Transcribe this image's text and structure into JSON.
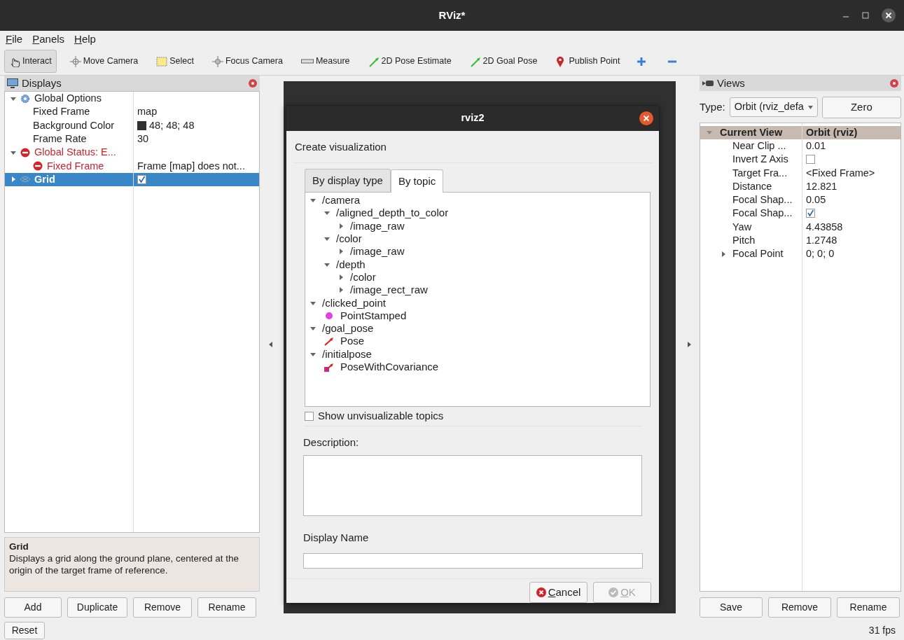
{
  "window": {
    "title": "RViz*"
  },
  "menu": [
    {
      "label": "File"
    },
    {
      "label": "Panels"
    },
    {
      "label": "Help"
    }
  ],
  "toolbar": [
    {
      "kind": "hand",
      "label": "Interact",
      "selected": true
    },
    {
      "kind": "move",
      "label": "Move Camera",
      "selected": false
    },
    {
      "kind": "select",
      "label": "Select",
      "selected": false
    },
    {
      "kind": "focus",
      "label": "Focus Camera",
      "selected": false
    },
    {
      "kind": "measure",
      "label": "Measure",
      "selected": false
    },
    {
      "kind": "arrow",
      "label": "2D Pose Estimate",
      "selected": false
    },
    {
      "kind": "arrow",
      "label": "2D Goal Pose",
      "selected": false
    },
    {
      "kind": "pin",
      "label": "Publish Point",
      "selected": false
    },
    {
      "kind": "plus",
      "selected": false
    },
    {
      "kind": "minus",
      "selected": false
    }
  ],
  "displays": {
    "title": "Displays",
    "tree": [
      {
        "kind": "options",
        "name": "Global Options",
        "expanded": true,
        "selected": false,
        "children": [
          {
            "kind": "property",
            "name": "Fixed Frame",
            "value": {
              "kind": "text",
              "text": "map"
            }
          },
          {
            "kind": "property",
            "name": "Background Color",
            "value": {
              "kind": "color",
              "text": "48; 48; 48",
              "color": "#303030"
            }
          },
          {
            "kind": "property",
            "name": "Frame Rate",
            "value": {
              "kind": "text",
              "text": "30"
            }
          }
        ]
      },
      {
        "kind": "error",
        "name": "Global Status: E...",
        "expanded": true,
        "selected": false,
        "children": [
          {
            "kind": "error",
            "name": "Fixed Frame",
            "value": {
              "kind": "text",
              "text": "Frame [map] does not..."
            }
          }
        ]
      },
      {
        "kind": "grid",
        "name": "Grid",
        "expanded": false,
        "selected": true,
        "value": {
          "kind": "checkbox",
          "checked": true
        }
      }
    ],
    "description": {
      "title": "Grid",
      "text": "Displays a grid along the ground plane, centered at the origin of the target frame of reference."
    },
    "buttons": [
      "Add",
      "Duplicate",
      "Remove",
      "Rename"
    ]
  },
  "reset_button": "Reset",
  "dialog": {
    "title": "rviz2",
    "heading": "Create visualization",
    "tabs": [
      {
        "label": "By display type",
        "selected": false
      },
      {
        "label": "By topic",
        "selected": true
      }
    ],
    "topics": [
      {
        "kind": "topic",
        "label": "/camera",
        "expanded": true,
        "children": [
          {
            "kind": "topic",
            "label": "/aligned_depth_to_color",
            "expanded": true,
            "children": [
              {
                "kind": "topic",
                "label": "/image_raw",
                "expanded": false
              }
            ]
          },
          {
            "kind": "topic",
            "label": "/color",
            "expanded": true,
            "children": [
              {
                "kind": "topic",
                "label": "/image_raw",
                "expanded": false
              }
            ]
          },
          {
            "kind": "topic",
            "label": "/depth",
            "expanded": true,
            "children": [
              {
                "kind": "topic",
                "label": "/color",
                "expanded": false
              },
              {
                "kind": "topic",
                "label": "/image_rect_raw",
                "expanded": false
              }
            ]
          }
        ]
      },
      {
        "kind": "topic",
        "label": "/clicked_point",
        "expanded": true,
        "children": [
          {
            "kind": "point",
            "label": "PointStamped"
          }
        ]
      },
      {
        "kind": "topic",
        "label": "/goal_pose",
        "expanded": true,
        "children": [
          {
            "kind": "pose",
            "label": "Pose"
          }
        ]
      },
      {
        "kind": "topic",
        "label": "/initialpose",
        "expanded": true,
        "children": [
          {
            "kind": "pose_cov",
            "label": "PoseWithCovariance"
          }
        ]
      }
    ],
    "show_unvisualizable": {
      "label": "Show unvisualizable topics",
      "checked": false
    },
    "description_label": "Description:",
    "display_name_label": "Display Name",
    "buttons": [
      {
        "kind": "cancel",
        "label": "Cancel",
        "disabled": false
      },
      {
        "kind": "ok",
        "label": "OK",
        "disabled": true
      }
    ]
  },
  "views": {
    "title": "Views",
    "type_label": "Type:",
    "type_value": "Orbit (rviz_defa",
    "zero_button": "Zero",
    "header": {
      "name": "Current View",
      "value": "Orbit (rviz)",
      "expanded": true
    },
    "rows": [
      {
        "name": "Near Clip ...",
        "value": {
          "kind": "text",
          "text": "0.01"
        }
      },
      {
        "name": "Invert Z Axis",
        "value": {
          "kind": "checkbox",
          "checked": false
        }
      },
      {
        "name": "Target Fra...",
        "value": {
          "kind": "text",
          "text": "<Fixed Frame>"
        }
      },
      {
        "name": "Distance",
        "value": {
          "kind": "text",
          "text": "12.821"
        }
      },
      {
        "name": "Focal Shap...",
        "value": {
          "kind": "text",
          "text": "0.05"
        }
      },
      {
        "name": "Focal Shap...",
        "value": {
          "kind": "checkbox",
          "checked": true
        }
      },
      {
        "name": "Yaw",
        "value": {
          "kind": "text",
          "text": "4.43858"
        }
      },
      {
        "name": "Pitch",
        "value": {
          "kind": "text",
          "text": "1.2748"
        }
      },
      {
        "name": "Focal Point",
        "expanded": false,
        "value": {
          "kind": "text",
          "text": "0; 0; 0"
        }
      }
    ],
    "buttons": [
      "Save",
      "Remove",
      "Rename"
    ]
  },
  "status": {
    "fps": "31 fps"
  }
}
